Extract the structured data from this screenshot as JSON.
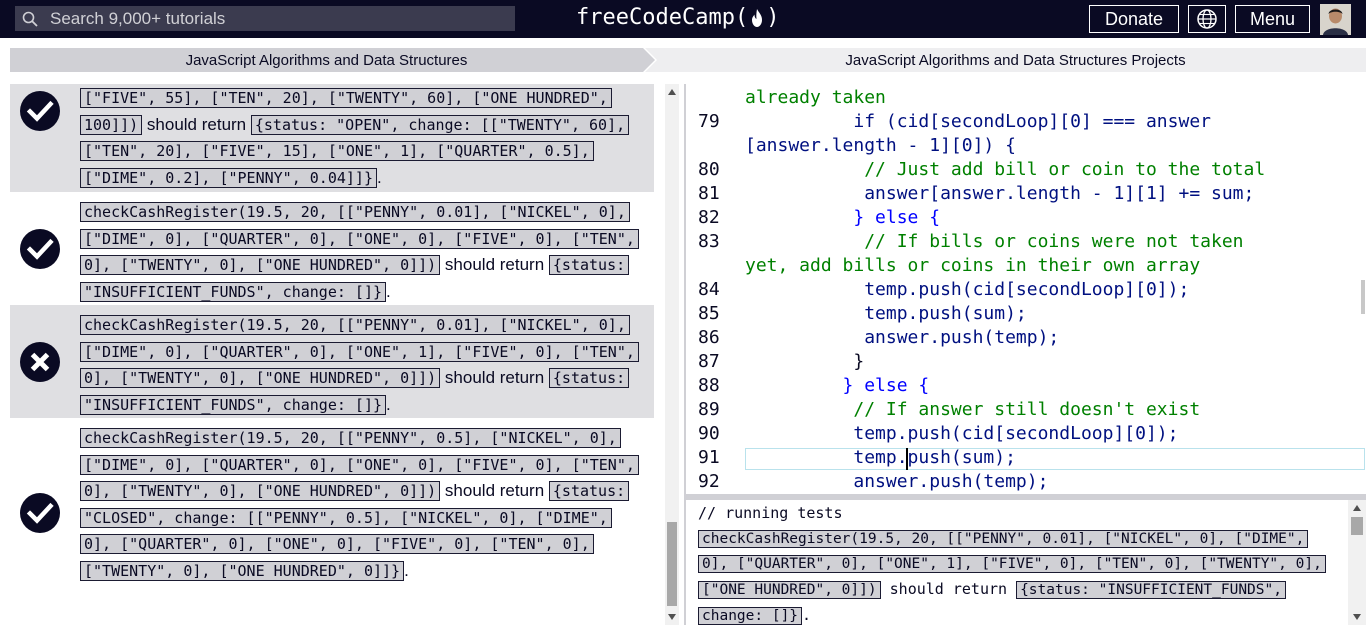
{
  "nav": {
    "search_placeholder": "Search 9,000+ tutorials",
    "logo_text_left": "freeCodeCamp(",
    "logo_text_right": ")",
    "donate_label": "Donate",
    "menu_label": "Menu",
    "background_color": "#0a0a23"
  },
  "breadcrumb": {
    "superblock": "JavaScript Algorithms and Data Structures",
    "block": "JavaScript Algorithms and Data Structures Projects"
  },
  "tests": [
    {
      "status": "pass",
      "code": "[\"FIVE\", 55], [\"TEN\", 20], [\"TWENTY\", 60], [\"ONE HUNDRED\", 100]])",
      "text": " should return ",
      "expected": "{status: \"OPEN\", change: [[\"TWENTY\", 60], [\"TEN\", 20], [\"FIVE\", 15], [\"ONE\", 1], [\"QUARTER\", 0.5], [\"DIME\", 0.2], [\"PENNY\", 0.04]]}",
      "end": "."
    },
    {
      "status": "pass",
      "code": "checkCashRegister(19.5, 20, [[\"PENNY\", 0.01], [\"NICKEL\", 0], [\"DIME\", 0], [\"QUARTER\", 0], [\"ONE\", 0], [\"FIVE\", 0], [\"TEN\", 0], [\"TWENTY\", 0], [\"ONE HUNDRED\", 0]])",
      "text": " should return ",
      "expected": "{status: \"INSUFFICIENT_FUNDS\", change: []}",
      "end": "."
    },
    {
      "status": "fail",
      "code": "checkCashRegister(19.5, 20, [[\"PENNY\", 0.01], [\"NICKEL\", 0], [\"DIME\", 0], [\"QUARTER\", 0], [\"ONE\", 1], [\"FIVE\", 0], [\"TEN\", 0], [\"TWENTY\", 0], [\"ONE HUNDRED\", 0]])",
      "text": " should return ",
      "expected": "{status: \"INSUFFICIENT_FUNDS\", change: []}",
      "end": "."
    },
    {
      "status": "pass",
      "code": "checkCashRegister(19.5, 20, [[\"PENNY\", 0.5], [\"NICKEL\", 0], [\"DIME\", 0], [\"QUARTER\", 0], [\"ONE\", 0], [\"FIVE\", 0], [\"TEN\", 0], [\"TWENTY\", 0], [\"ONE HUNDRED\", 0]])",
      "text": " should return ",
      "expected": "{status: \"CLOSED\", change: [[\"PENNY\", 0.5], [\"NICKEL\", 0], [\"DIME\", 0], [\"QUARTER\", 0], [\"ONE\", 0], [\"FIVE\", 0], [\"TEN\", 0], [\"TWENTY\", 0], [\"ONE HUNDRED\", 0]]}",
      "end": "."
    }
  ],
  "editor": {
    "lines": [
      {
        "n": "",
        "code": "already taken"
      },
      {
        "n": "79",
        "code": "          if (cid[secondLoop][0] === answer"
      },
      {
        "n": "",
        "code": "[answer.length - 1][0]) {"
      },
      {
        "n": "80",
        "code": "           // Just add bill or coin to the total"
      },
      {
        "n": "81",
        "code": "           answer[answer.length - 1][1] += sum;"
      },
      {
        "n": "82",
        "code": "          } else {"
      },
      {
        "n": "83",
        "code": "           // If bills or coins were not taken"
      },
      {
        "n": "",
        "code": "yet, add bills or coins in their own array"
      },
      {
        "n": "84",
        "code": "           temp.push(cid[secondLoop][0]);"
      },
      {
        "n": "85",
        "code": "           temp.push(sum);"
      },
      {
        "n": "86",
        "code": "           answer.push(temp);"
      },
      {
        "n": "87",
        "code": "          }"
      },
      {
        "n": "88",
        "code": "         } else {"
      },
      {
        "n": "89",
        "code": "          // If answer still doesn't exist"
      },
      {
        "n": "90",
        "code": "          temp.push(cid[secondLoop][0]);"
      },
      {
        "n": "91",
        "code": "          temp.push(sum);"
      },
      {
        "n": "92",
        "code": "          answer.push(temp);"
      }
    ]
  },
  "console": {
    "comment": "// running tests",
    "code": "checkCashRegister(19.5, 20, [[\"PENNY\", 0.01], [\"NICKEL\", 0], [\"DIME\", 0], [\"QUARTER\", 0], [\"ONE\", 1], [\"FIVE\", 0], [\"TEN\", 0], [\"TWENTY\", 0], [\"ONE HUNDRED\", 0]])",
    "text": " should return ",
    "expected": "{status: \"INSUFFICIENT_FUNDS\", change: []}",
    "end": "."
  }
}
